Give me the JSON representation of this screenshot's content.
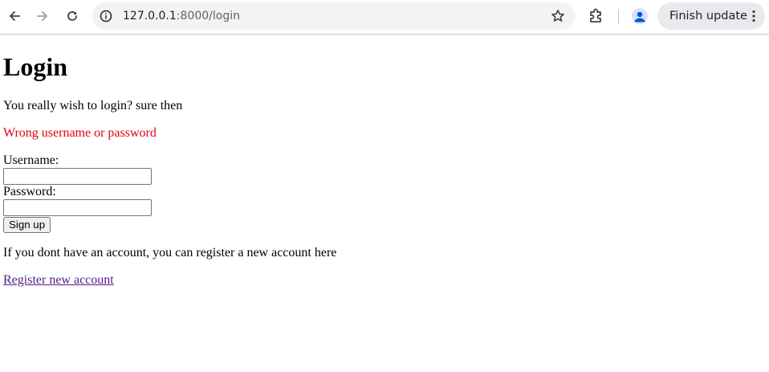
{
  "browser": {
    "url_host": "127.0.0.1",
    "url_path": ":8000/login",
    "finish_update_label": "Finish update",
    "icons": [
      "back-arrow-icon",
      "forward-arrow-icon",
      "reload-icon",
      "site-info-icon",
      "bookmark-star-icon",
      "extensions-puzzle-icon",
      "profile-avatar-icon",
      "more-vertical-icon"
    ]
  },
  "page": {
    "heading": "Login",
    "intro": "You really wish to login? sure then",
    "error_message": "Wrong username or password",
    "username_label": "Username:",
    "username_value": "",
    "password_label": "Password:",
    "password_value": "",
    "submit_label": "Sign up",
    "register_hint": "If you dont have an account, you can register a new account here",
    "register_link": "Register new account"
  },
  "colors": {
    "error": "#e3000f",
    "visited_link": "#551a8b"
  }
}
